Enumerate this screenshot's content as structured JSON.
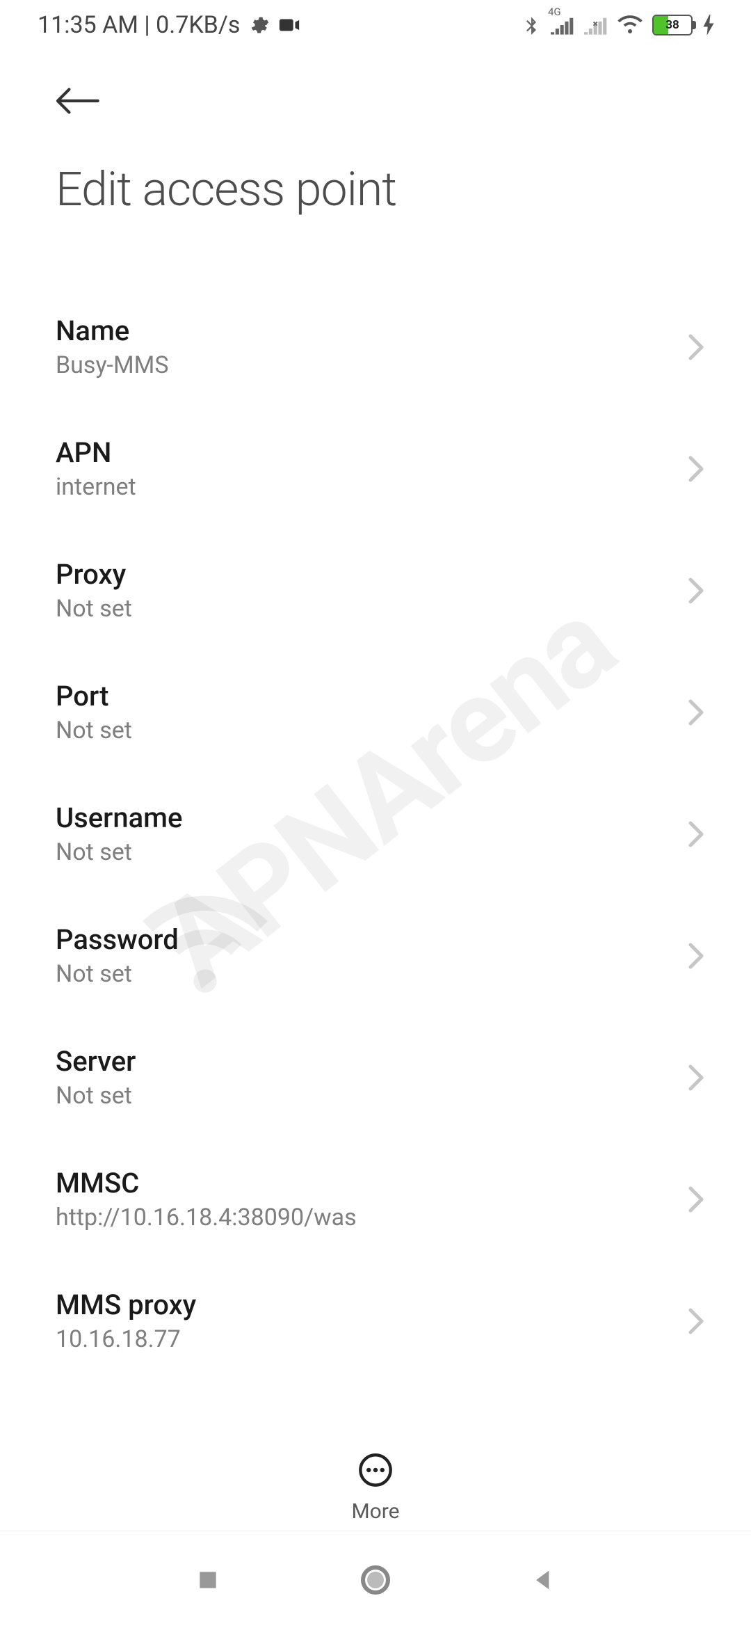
{
  "status_bar": {
    "time_and_rate": "11:35 AM | 0.7KB/s",
    "signal_label": "4G",
    "battery_percent": "38"
  },
  "page": {
    "title": "Edit access point"
  },
  "settings": [
    {
      "label": "Name",
      "value": "Busy-MMS"
    },
    {
      "label": "APN",
      "value": "internet"
    },
    {
      "label": "Proxy",
      "value": "Not set"
    },
    {
      "label": "Port",
      "value": "Not set"
    },
    {
      "label": "Username",
      "value": "Not set"
    },
    {
      "label": "Password",
      "value": "Not set"
    },
    {
      "label": "Server",
      "value": "Not set"
    },
    {
      "label": "MMSC",
      "value": "http://10.16.18.4:38090/was"
    },
    {
      "label": "MMS proxy",
      "value": "10.16.18.77"
    }
  ],
  "bottom_bar": {
    "more_label": "More"
  },
  "watermark": "APNArena"
}
